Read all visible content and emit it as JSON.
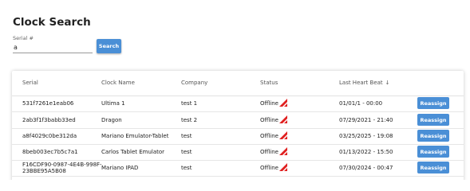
{
  "page": {
    "title": "Clock Search"
  },
  "search": {
    "label": "Serial #",
    "value": "a",
    "button_label": "Search"
  },
  "table": {
    "columns": {
      "serial": "Serial",
      "clock_name": "Clock Name",
      "company": "Company",
      "status": "Status",
      "last_heart_beat": "Last Heart Beat"
    },
    "sort_indicator": "↓",
    "rows": [
      {
        "serial": "531f7261e1eab06",
        "clock_name": "Ultima 1",
        "company": "test 1",
        "status": "Offline",
        "last_heart_beat": "01/01/1 - 00:00",
        "action": "Reassign"
      },
      {
        "serial": "2ab3f1f3babb33ed",
        "clock_name": "Dragon",
        "company": "test 2",
        "status": "Offline",
        "last_heart_beat": "07/29/2021 - 21:40",
        "action": "Reassign"
      },
      {
        "serial": "a8f4029c0be312da",
        "clock_name": "Mariano Emulator-Tablet",
        "company": "test",
        "status": "Offline",
        "last_heart_beat": "03/25/2025 - 19:08",
        "action": "Reassign"
      },
      {
        "serial": "8beb003ec7b5c7a1",
        "clock_name": "Carlos Tablet Emulator",
        "company": "test",
        "status": "Offline",
        "last_heart_beat": "01/13/2022 - 15:50",
        "action": "Reassign"
      },
      {
        "serial_line1": "F16CDF90-0987-4E4B-998F-",
        "serial_line2": "23BBE95A5B08",
        "clock_name": "Mariano IPAD",
        "company": "test",
        "status": "Offline",
        "last_heart_beat": "07/30/2024 - 00:47",
        "action": "Reassign"
      }
    ]
  },
  "colors": {
    "accent": "#4a8fd6",
    "offline_flag": "#e02020"
  },
  "icons": {
    "status_flag": "offline-flag-icon",
    "sort": "sort-down-arrow-icon"
  }
}
